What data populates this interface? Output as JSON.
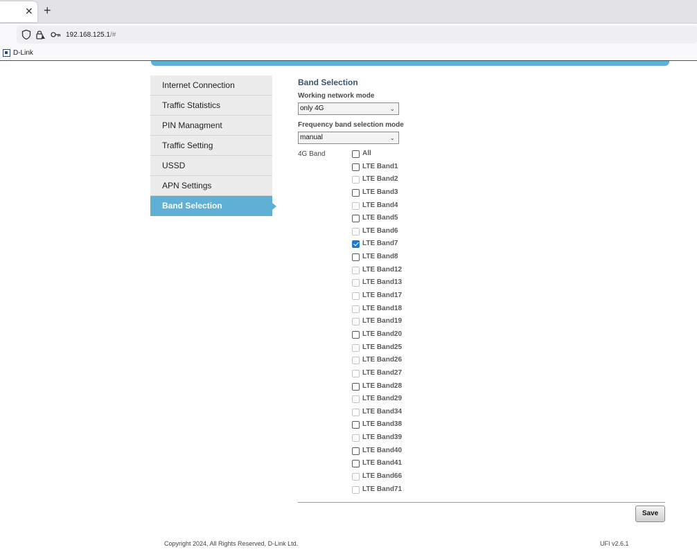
{
  "browser": {
    "tab_close": "✕",
    "new_tab": "+",
    "url_host": "192.168.125.1",
    "url_rest": "/#",
    "bookmark_label": "D-Link"
  },
  "sidebar": {
    "items": [
      {
        "label": "Internet Connection",
        "active": false
      },
      {
        "label": "Traffic Statistics",
        "active": false
      },
      {
        "label": "PIN Managment",
        "active": false
      },
      {
        "label": "Traffic Setting",
        "active": false
      },
      {
        "label": "USSD",
        "active": false
      },
      {
        "label": "APN Settings",
        "active": false
      },
      {
        "label": "Band Selection",
        "active": true
      }
    ]
  },
  "main": {
    "title": "Band Selection",
    "network_mode_label": "Working network mode",
    "network_mode_value": "only 4G",
    "freq_mode_label": "Frequency band selection mode",
    "freq_mode_value": "manual",
    "band_group_label": "4G Band",
    "bands": [
      {
        "label": "All",
        "checked": false,
        "enabled": true
      },
      {
        "label": "LTE Band1",
        "checked": false,
        "enabled": true
      },
      {
        "label": "LTE Band2",
        "checked": false,
        "enabled": false
      },
      {
        "label": "LTE Band3",
        "checked": false,
        "enabled": true
      },
      {
        "label": "LTE Band4",
        "checked": false,
        "enabled": false
      },
      {
        "label": "LTE Band5",
        "checked": false,
        "enabled": true
      },
      {
        "label": "LTE Band6",
        "checked": false,
        "enabled": false
      },
      {
        "label": "LTE Band7",
        "checked": true,
        "enabled": true
      },
      {
        "label": "LTE Band8",
        "checked": false,
        "enabled": true
      },
      {
        "label": "LTE Band12",
        "checked": false,
        "enabled": false
      },
      {
        "label": "LTE Band13",
        "checked": false,
        "enabled": false
      },
      {
        "label": "LTE Band17",
        "checked": false,
        "enabled": false
      },
      {
        "label": "LTE Band18",
        "checked": false,
        "enabled": false
      },
      {
        "label": "LTE Band19",
        "checked": false,
        "enabled": false
      },
      {
        "label": "LTE Band20",
        "checked": false,
        "enabled": true
      },
      {
        "label": "LTE Band25",
        "checked": false,
        "enabled": false
      },
      {
        "label": "LTE Band26",
        "checked": false,
        "enabled": false
      },
      {
        "label": "LTE Band27",
        "checked": false,
        "enabled": false
      },
      {
        "label": "LTE Band28",
        "checked": false,
        "enabled": true
      },
      {
        "label": "LTE Band29",
        "checked": false,
        "enabled": false
      },
      {
        "label": "LTE Band34",
        "checked": false,
        "enabled": false
      },
      {
        "label": "LTE Band38",
        "checked": false,
        "enabled": true
      },
      {
        "label": "LTE Band39",
        "checked": false,
        "enabled": false
      },
      {
        "label": "LTE Band40",
        "checked": false,
        "enabled": true
      },
      {
        "label": "LTE Band41",
        "checked": false,
        "enabled": true
      },
      {
        "label": "LTE Band66",
        "checked": false,
        "enabled": false
      },
      {
        "label": "LTE Band71",
        "checked": false,
        "enabled": false
      }
    ],
    "save_label": "Save"
  },
  "footer": {
    "copyright": "Copyright 2024, All Rights Reserved, D-Link Ltd.",
    "version": "UFI v2.6.1"
  },
  "colors": {
    "accent": "#5fb0d4",
    "checkbox_checked": "#1e78d4"
  }
}
